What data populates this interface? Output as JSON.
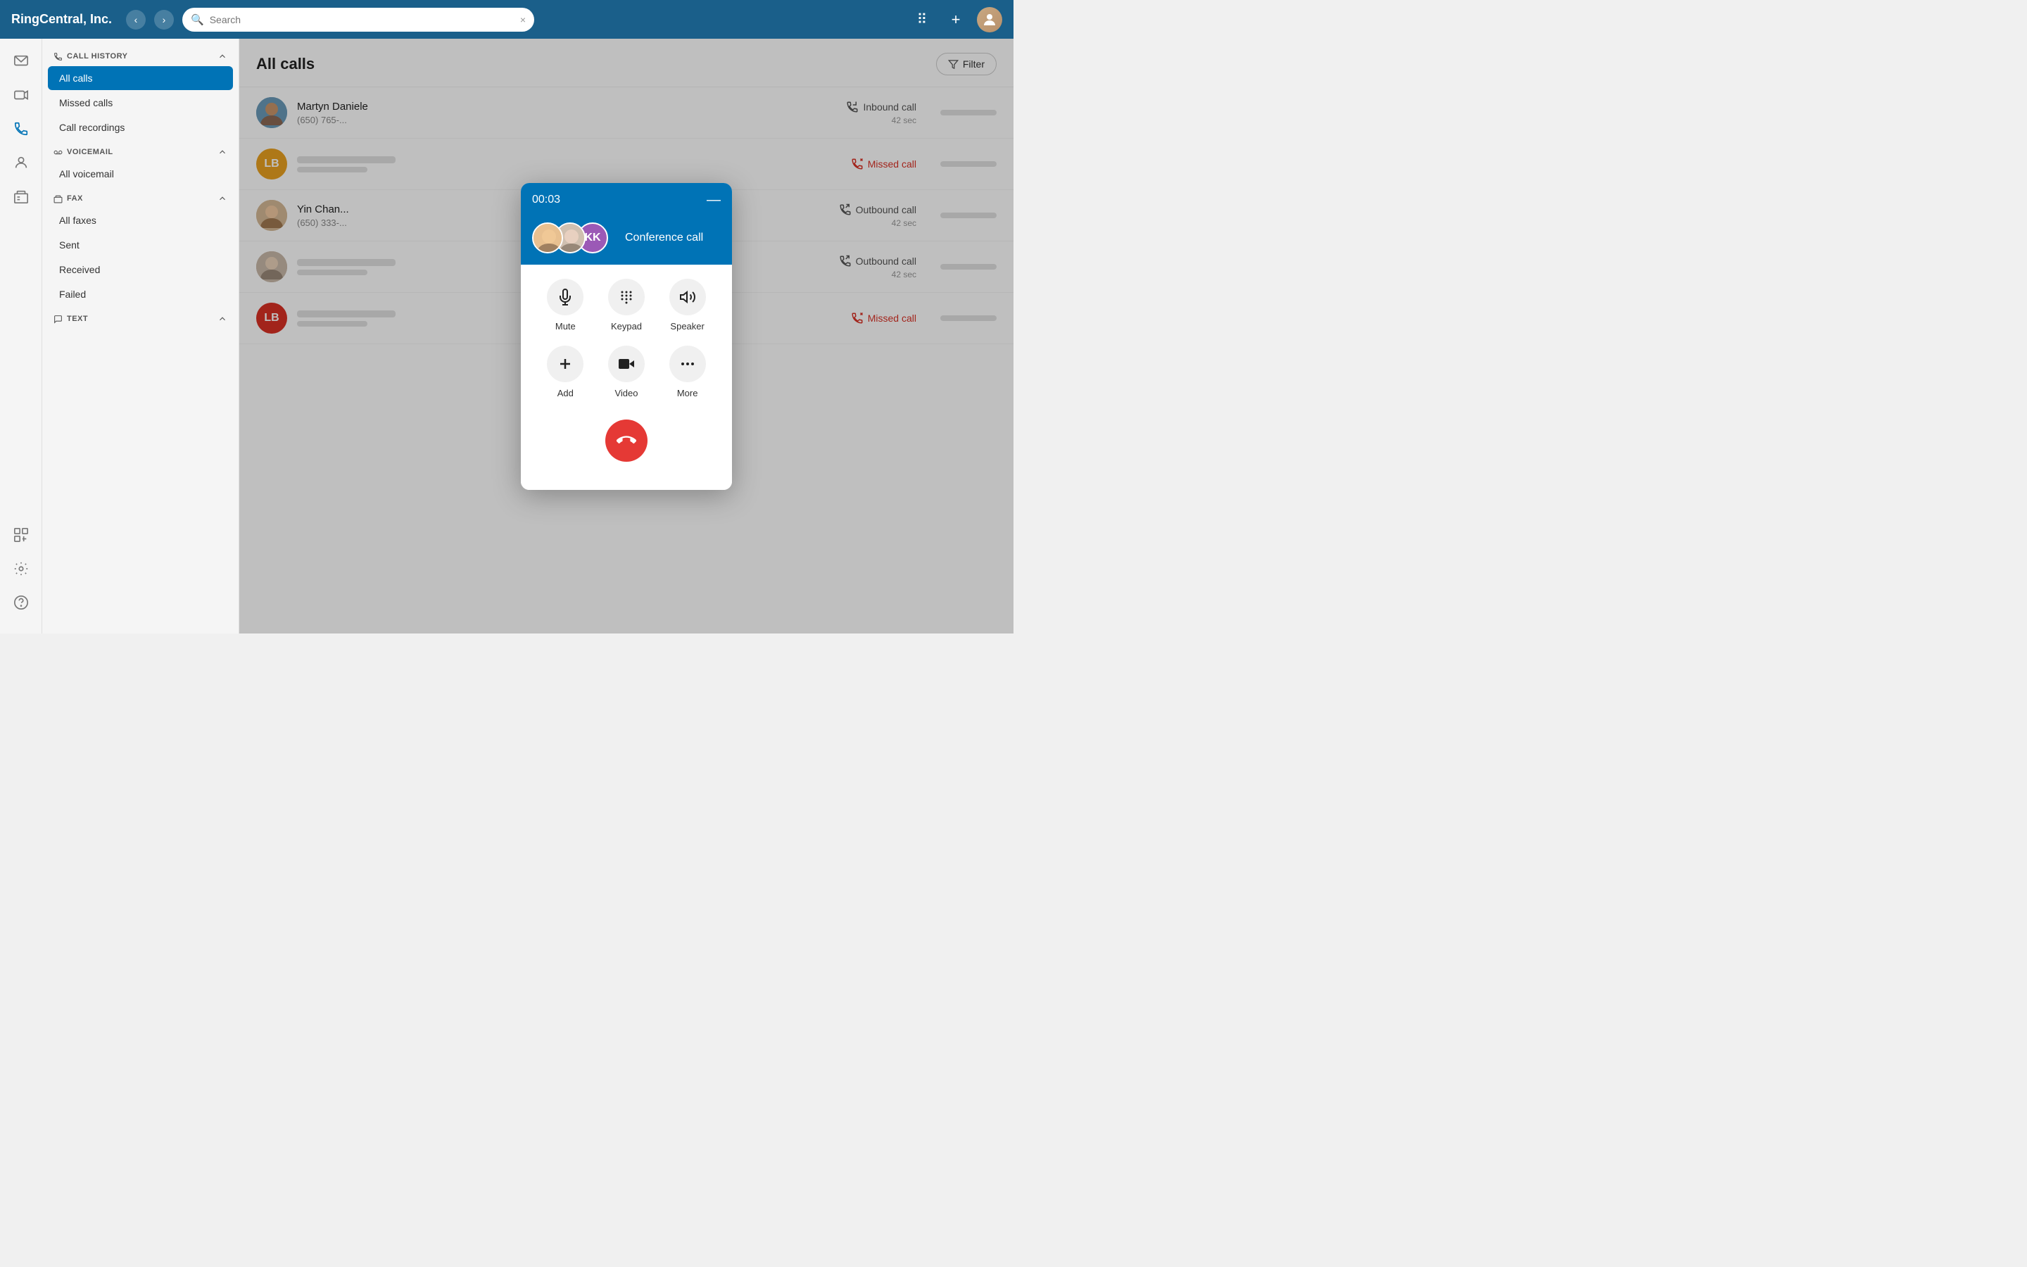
{
  "app": {
    "title": "RingCentral, Inc.",
    "search_placeholder": "Search"
  },
  "topbar": {
    "logo": "RingCentral, Inc.",
    "search_placeholder": "Search",
    "add_label": "+",
    "close_icon": "×"
  },
  "sidebar": {
    "call_history_label": "CALL HISTORY",
    "items": [
      {
        "id": "all-calls",
        "label": "All calls",
        "active": true
      },
      {
        "id": "missed-calls",
        "label": "Missed calls",
        "active": false
      },
      {
        "id": "call-recordings",
        "label": "Call recordings",
        "active": false
      }
    ],
    "voicemail_label": "VOICEMAIL",
    "voicemail_items": [
      {
        "id": "all-voicemail",
        "label": "All voicemail"
      }
    ],
    "fax_label": "FAX",
    "fax_items": [
      {
        "id": "all-faxes",
        "label": "All faxes"
      },
      {
        "id": "sent",
        "label": "Sent"
      },
      {
        "id": "received",
        "label": "Received"
      },
      {
        "id": "failed",
        "label": "Failed"
      }
    ],
    "text_label": "TEXT"
  },
  "content": {
    "title": "All calls",
    "filter_label": "Filter"
  },
  "calls": [
    {
      "id": 1,
      "name": "Martyn Daniele",
      "number": "(650) 765-...",
      "type": "Inbound call",
      "duration": "42 sec",
      "missed": false,
      "avatar_text": "",
      "avatar_color": "#5a7fa0",
      "has_photo": true,
      "photo_seed": "man1"
    },
    {
      "id": 2,
      "name": "",
      "number": "",
      "type": "Missed call",
      "duration": "",
      "missed": true,
      "avatar_text": "LB",
      "avatar_color": "#e8a020",
      "has_photo": false
    },
    {
      "id": 3,
      "name": "Yin Chan...",
      "number": "(650) 333-...",
      "type": "Outbound call",
      "duration": "42 sec",
      "missed": false,
      "avatar_text": "",
      "avatar_color": "#c0a080",
      "has_photo": true,
      "photo_seed": "woman1"
    },
    {
      "id": 4,
      "name": "",
      "number": "",
      "type": "Outbound call",
      "duration": "42 sec",
      "missed": false,
      "avatar_text": "",
      "avatar_color": "#c0a080",
      "has_photo": true,
      "photo_seed": "woman2"
    },
    {
      "id": 5,
      "name": "",
      "number": "",
      "type": "Missed call",
      "duration": "",
      "missed": true,
      "avatar_text": "LB",
      "avatar_color": "#d93025",
      "has_photo": false
    }
  ],
  "call_modal": {
    "timer": "00:03",
    "minimize_label": "—",
    "conference_label": "Conference call",
    "controls": [
      {
        "id": "mute",
        "label": "Mute",
        "icon": "🎤"
      },
      {
        "id": "keypad",
        "label": "Keypad",
        "icon": "⠿"
      },
      {
        "id": "speaker",
        "label": "Speaker",
        "icon": "🔊"
      },
      {
        "id": "add",
        "label": "Add",
        "icon": "+"
      },
      {
        "id": "video",
        "label": "Video",
        "icon": "📹"
      },
      {
        "id": "more",
        "label": "More",
        "icon": "•••"
      }
    ],
    "end_call_icon": "📞"
  }
}
